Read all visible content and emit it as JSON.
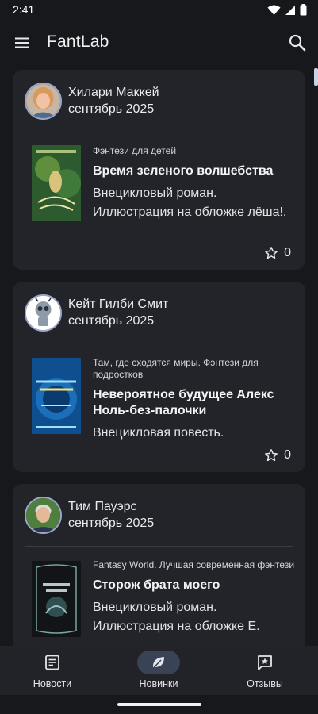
{
  "status_bar": {
    "time": "2:41"
  },
  "app_bar": {
    "title": "FantLab"
  },
  "feed": [
    {
      "author": "Хилари Маккей",
      "date": "сентябрь 2025",
      "series": "Фэнтези для детей",
      "title": "Время зеленого волшебства",
      "description": "Внецикловый роман. Иллюстрация на обложке лёша!.",
      "rating": "0"
    },
    {
      "author": "Кейт Гилби Смит",
      "date": "сентябрь 2025",
      "series": "Там, где сходятся миры. Фэнтези для подростков",
      "title": "Невероятное будущее Алекс Ноль-без-палочки",
      "description": "Внецикловая повесть.",
      "rating": "0"
    },
    {
      "author": "Тим Пауэрс",
      "date": "сентябрь 2025",
      "series": "Fantasy World. Лучшая современная фэнтези",
      "title": "Сторож брата моего",
      "description": "Внецикловый роман. Иллюстрация на обложке Е."
    }
  ],
  "bottom_nav": [
    {
      "label": "Новости",
      "icon": "article-icon"
    },
    {
      "label": "Новинки",
      "icon": "leaf-icon",
      "active": true
    },
    {
      "label": "Отзывы",
      "icon": "review-icon"
    }
  ],
  "colors": {
    "background": "#17181c",
    "card": "#222429",
    "active_nav": "#3a4355"
  }
}
